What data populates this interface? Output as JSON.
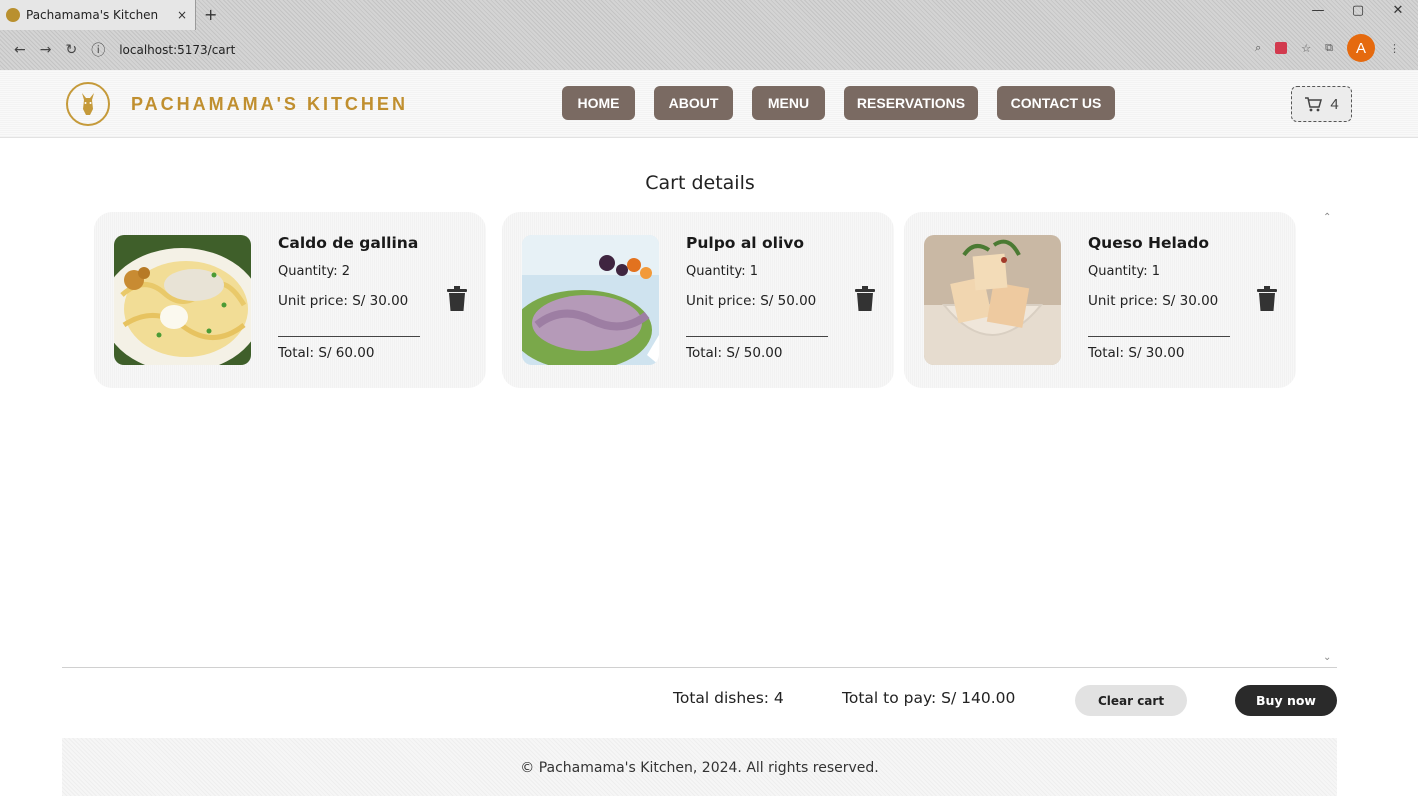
{
  "browser": {
    "tab_title": "Pachamama's Kitchen",
    "tab_close": "×",
    "new_tab": "+",
    "url": "localhost:5173/cart",
    "avatar_letter": "A",
    "window_controls": [
      "—",
      "▢",
      "✕"
    ],
    "nav_icons": [
      "arrow-left-icon",
      "arrow-right-icon",
      "reload-icon"
    ]
  },
  "header": {
    "brand": "PACHAMAMA'S KITCHEN",
    "nav": [
      {
        "label": "HOME"
      },
      {
        "label": "ABOUT"
      },
      {
        "label": "MENU"
      },
      {
        "label": "RESERVATIONS"
      },
      {
        "label": "CONTACT US"
      }
    ],
    "cart_count": "4"
  },
  "main": {
    "title": "Cart details",
    "items": [
      {
        "name": "Caldo de gallina",
        "quantity": "Quantity: 2",
        "unit_price": "Unit price: S/ 30.00",
        "total": "Total: S/ 60.00"
      },
      {
        "name": "Pulpo al olivo",
        "quantity": "Quantity: 1",
        "unit_price": "Unit price: S/ 50.00",
        "total": "Total: S/ 50.00"
      },
      {
        "name": "Queso Helado",
        "quantity": "Quantity: 1",
        "unit_price": "Unit price: S/ 30.00",
        "total": "Total: S/ 30.00"
      }
    ]
  },
  "summary": {
    "total_dishes": "Total dishes: 4",
    "total_to_pay": "Total to pay: S/ 140.00",
    "clear_label": "Clear cart",
    "buy_label": "Buy now"
  },
  "footer": {
    "text": "© Pachamama's Kitchen, 2024. All rights reserved."
  },
  "colors": {
    "nav_button": "#7a6a62",
    "brand_gold": "#c08f2f",
    "buy_button": "#2a2a2a",
    "avatar": "#e56a0f"
  }
}
